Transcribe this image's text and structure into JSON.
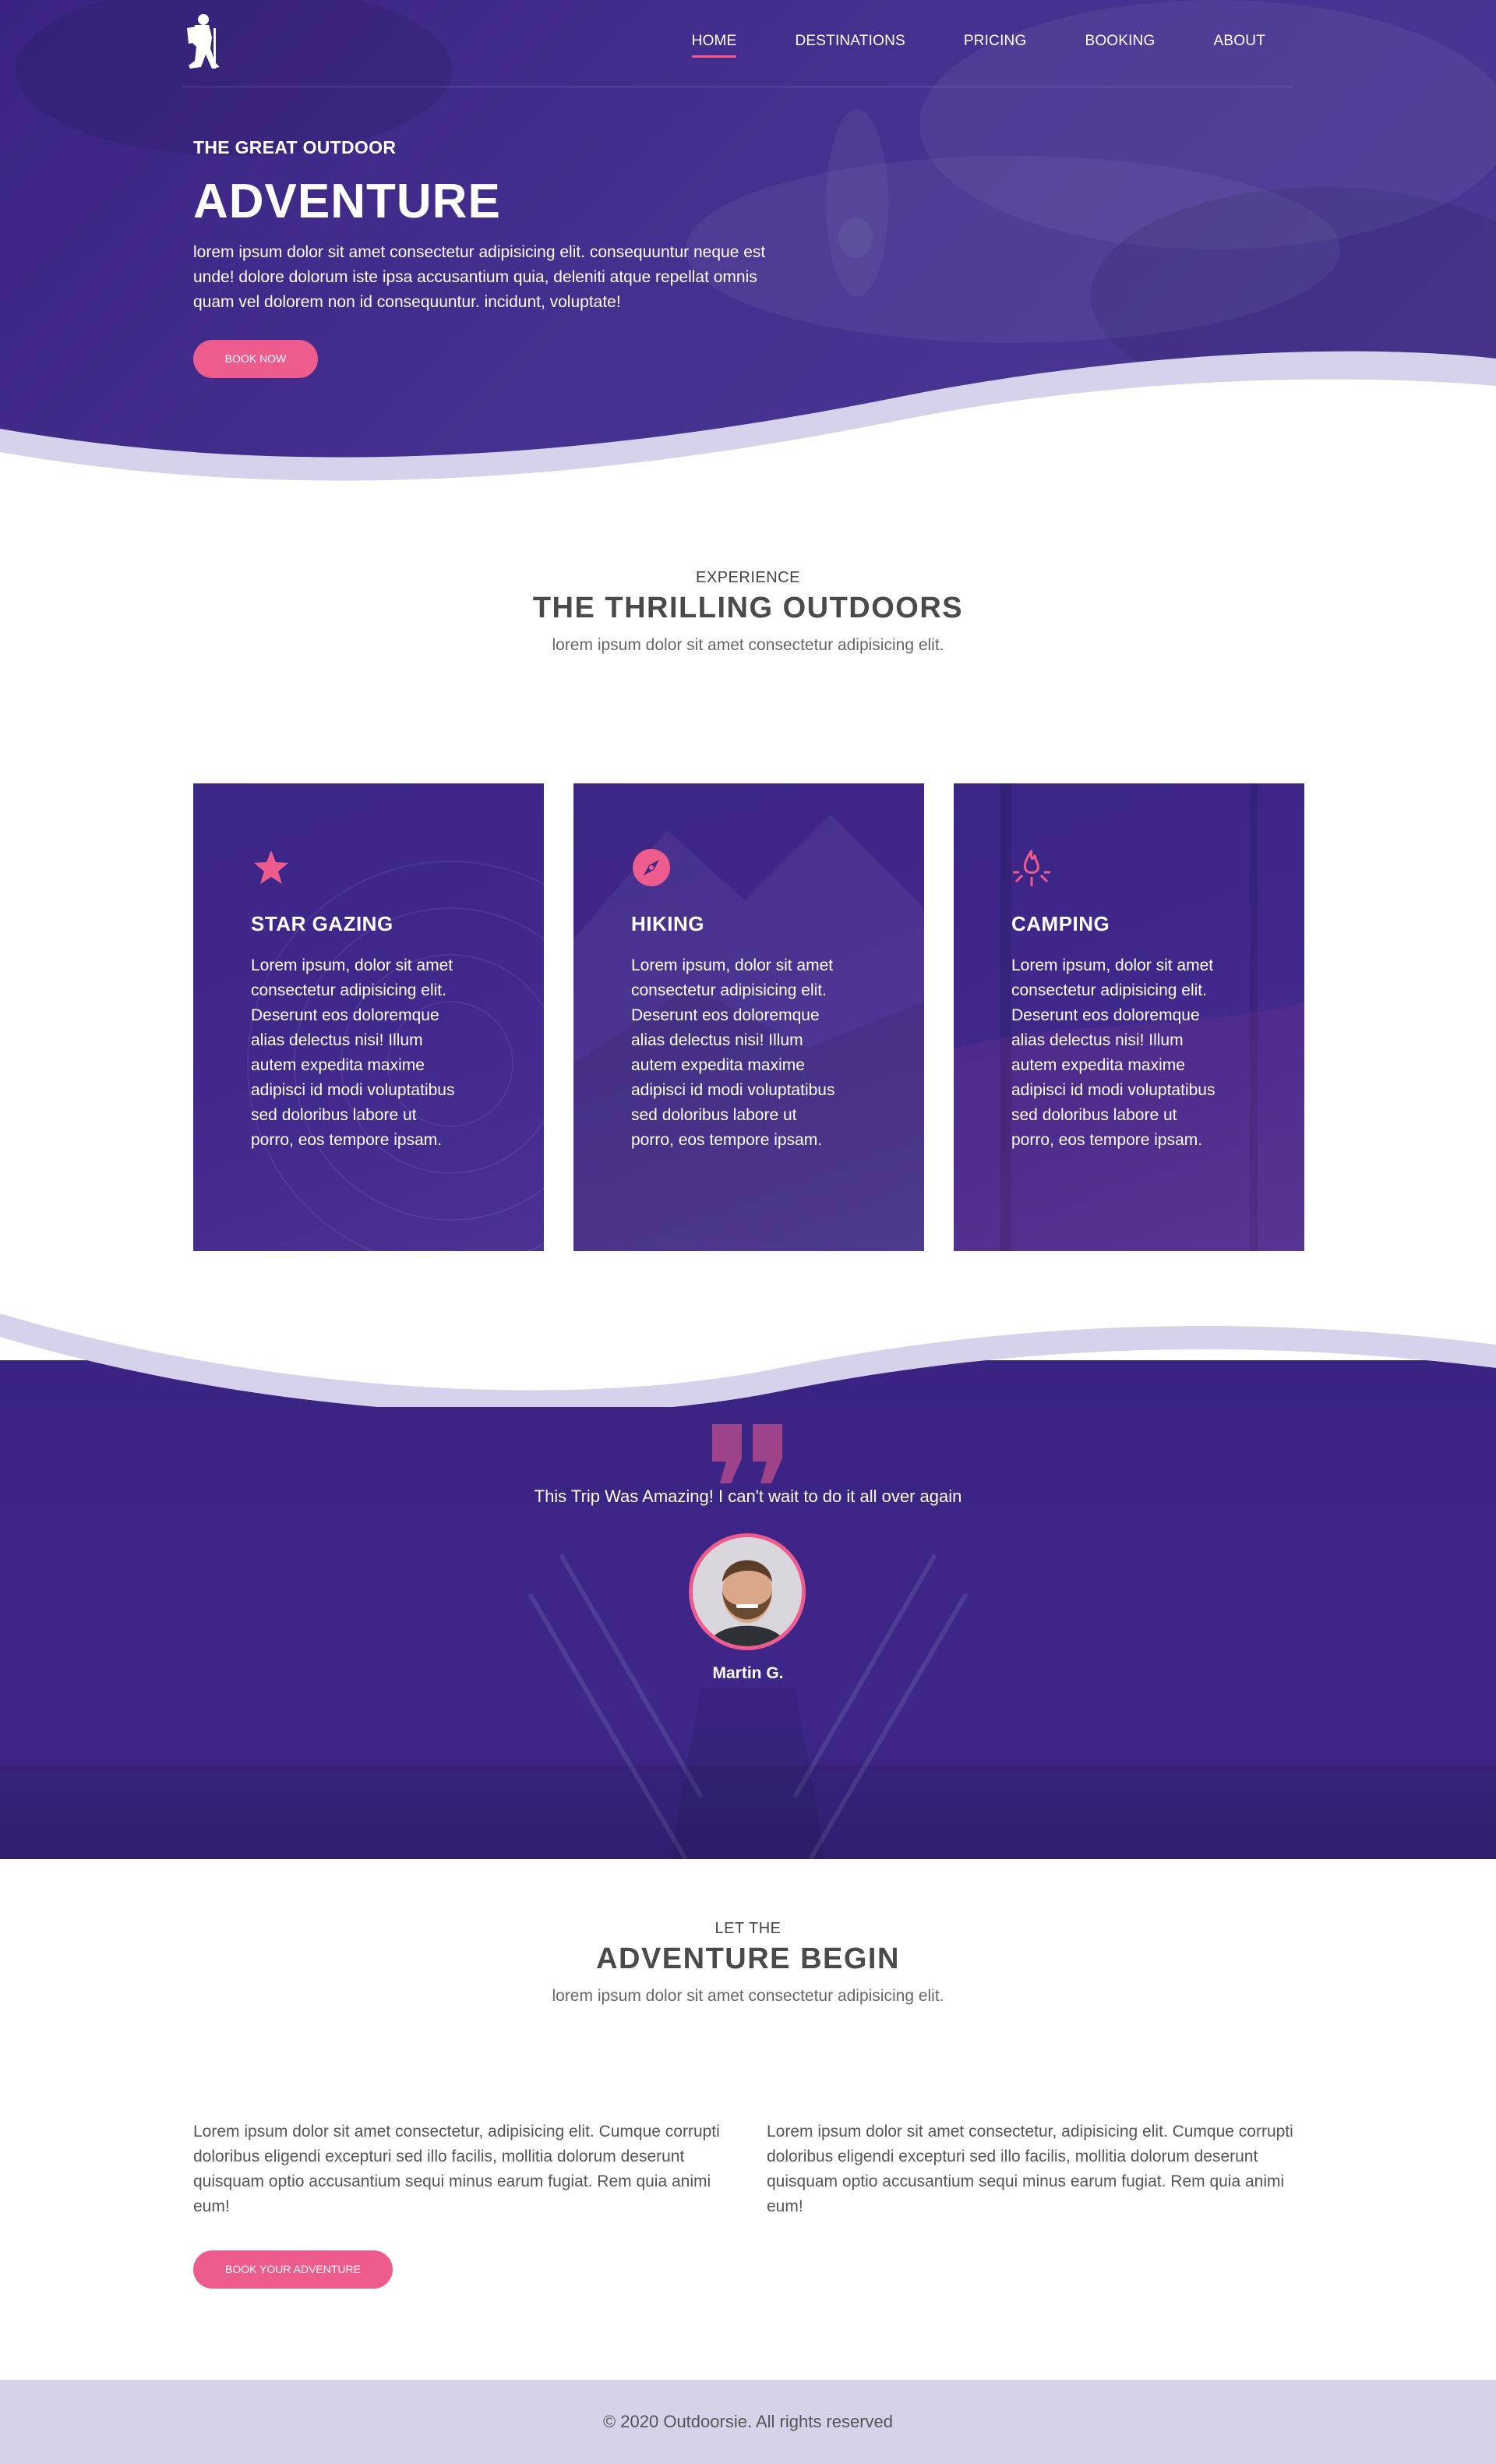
{
  "nav": {
    "items": [
      {
        "label": "HOME",
        "active": true
      },
      {
        "label": "DESTINATIONS",
        "active": false
      },
      {
        "label": "PRICING",
        "active": false
      },
      {
        "label": "BOOKING",
        "active": false
      },
      {
        "label": "ABOUT",
        "active": false
      }
    ]
  },
  "hero": {
    "kicker": "THE GREAT OUTDOOR",
    "title": "ADVENTURE",
    "text": "lorem ipsum dolor sit amet consectetur adipisicing elit. consequuntur neque est unde! dolore dolorum iste ipsa accusantium quia, deleniti atque repellat omnis quam vel dolorem non id consequuntur. incidunt, voluptate!",
    "button": "BOOK NOW"
  },
  "experience": {
    "kicker": "EXPERIENCE",
    "title": "THE THRILLING OUTDOORS",
    "subtitle": "lorem ipsum dolor sit amet consectetur adipisicing elit."
  },
  "cards": [
    {
      "icon": "star-icon",
      "title": "STAR GAZING",
      "text": "Lorem ipsum, dolor sit amet consectetur adipisicing elit. Deserunt eos doloremque alias delectus nisi! Illum autem expedita maxime adipisci id modi voluptatibus sed doloribus labore ut porro, eos tempore ipsam."
    },
    {
      "icon": "compass-icon",
      "title": "HIKING",
      "text": "Lorem ipsum, dolor sit amet consectetur adipisicing elit. Deserunt eos doloremque alias delectus nisi! Illum autem expedita maxime adipisci id modi voluptatibus sed doloribus labore ut porro, eos tempore ipsam."
    },
    {
      "icon": "campfire-icon",
      "title": "CAMPING",
      "text": "Lorem ipsum, dolor sit amet consectetur adipisicing elit. Deserunt eos doloremque alias delectus nisi! Illum autem expedita maxime adipisci id modi voluptatibus sed doloribus labore ut porro, eos tempore ipsam."
    }
  ],
  "testimonial": {
    "quote": "This Trip Was Amazing! I can't wait to do it all over again",
    "name": "Martin G."
  },
  "adventure": {
    "kicker": "LET THE",
    "title": "ADVENTURE BEGIN",
    "subtitle": "lorem ipsum dolor sit amet consectetur adipisicing elit.",
    "columns": [
      "Lorem ipsum dolor sit amet consectetur, adipisicing elit. Cumque corrupti doloribus eligendi excepturi sed illo facilis, mollitia dolorum deserunt quisquam optio accusantium sequi minus earum fugiat. Rem quia animi eum!",
      "Lorem ipsum dolor sit amet consectetur, adipisicing elit. Cumque corrupti doloribus eligendi excepturi sed illo facilis, mollitia dolorum deserunt quisquam optio accusantium sequi minus earum fugiat. Rem quia animi eum!"
    ],
    "button": "BOOK YOUR ADVENTURE"
  },
  "footer": {
    "text": "© 2020 Outdoorsie. All rights reserved"
  },
  "colors": {
    "primary_purple": "#3f278a",
    "accent_pink": "#ee5c8e",
    "footer_bg": "#d6d2ea"
  }
}
